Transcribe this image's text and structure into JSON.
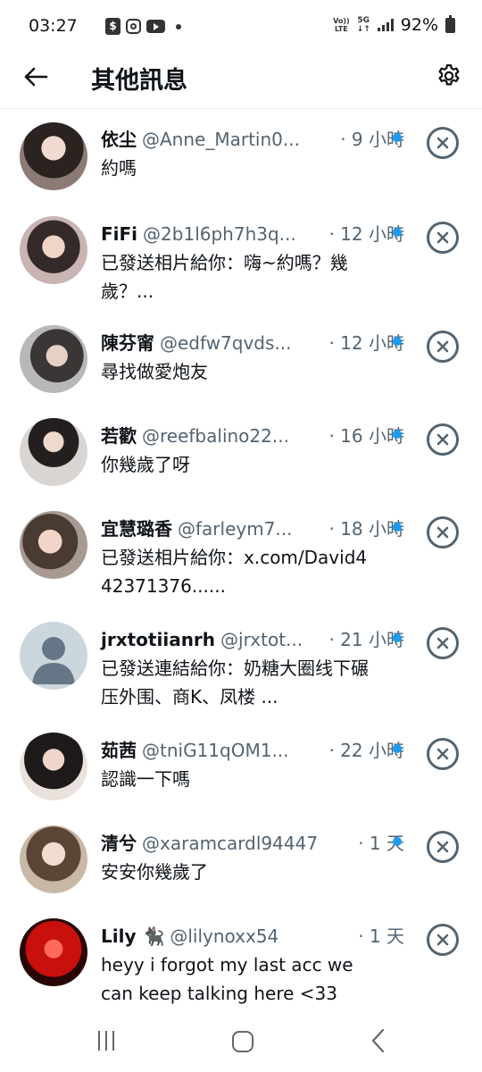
{
  "status_bar": {
    "time": "03:27",
    "battery": "92%",
    "network": "5G",
    "volte": "Vo)) LTE"
  },
  "header": {
    "title": "其他訊息"
  },
  "colors": {
    "unread_dot": "#1d9bf0",
    "secondary_text": "#536471"
  },
  "messages": [
    {
      "name": "依尘",
      "handle": "@Anne_Martin0...",
      "time": "· 9 小時",
      "text": "約嗎",
      "unread": true,
      "avatar": "photo"
    },
    {
      "name": "FiFi",
      "handle": "@2b1l6ph7h3q...",
      "time": "· 12 小時",
      "text": "已發送相片給你：嗨~約嗎？幾歲？...",
      "unread": true,
      "avatar": "photo"
    },
    {
      "name": "陳芬甯",
      "handle": "@edfw7qvds...",
      "time": "· 12 小時",
      "text": "尋找做愛炮友",
      "unread": true,
      "avatar": "photo"
    },
    {
      "name": "若歡",
      "handle": "@reefbalino22...",
      "time": "· 16 小時",
      "text": "你幾歲了呀",
      "unread": true,
      "avatar": "photo"
    },
    {
      "name": "宜慧璐香",
      "handle": "@farleym7...",
      "time": "· 18 小時",
      "text": "已發送相片給你：x.com/David442371376......",
      "unread": true,
      "avatar": "photo"
    },
    {
      "name": "jrxtotiianrh",
      "handle": "@jrxtot...",
      "time": "· 21 小時",
      "text": "已發送連結給你：奶糖大圈线下碾压外围、商K、凤楼 ...",
      "unread": true,
      "avatar": "default"
    },
    {
      "name": "茹茜",
      "handle": "@tniG11qOM1...",
      "time": "· 22 小時",
      "text": "認識一下嗎",
      "unread": true,
      "avatar": "photo"
    },
    {
      "name": "清兮",
      "handle": "@xaramcardl94447",
      "time": "· 1 天",
      "text": "安安你幾歲了",
      "unread": true,
      "avatar": "photo"
    },
    {
      "name": "Lily 🐈‍⬛",
      "handle": "@lilynoxx54",
      "time": "· 1 天",
      "text": "heyy i forgot my last acc we can keep talking here <33",
      "unread": false,
      "avatar": "photo-red"
    }
  ],
  "icons": {
    "back": "arrow-left-icon",
    "settings": "gear-icon",
    "dismiss": "close-circle-icon",
    "nav_recent": "recent-apps-icon",
    "nav_home": "home-icon",
    "nav_back": "chevron-left-icon"
  }
}
